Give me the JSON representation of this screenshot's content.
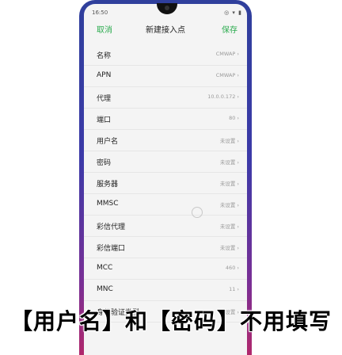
{
  "status": {
    "time": "16:50",
    "icons": "◎ ▾ ▮"
  },
  "header": {
    "cancel_label": "取消",
    "title": "新建接入点",
    "save_label": "保存"
  },
  "rows": [
    {
      "label": "名称",
      "value": "CMWAP ›"
    },
    {
      "label": "APN",
      "value": "CMWAP ›"
    },
    {
      "label": "代理",
      "value": "10.0.0.172 ›"
    },
    {
      "label": "端口",
      "value": "80 ›"
    },
    {
      "label": "用户名",
      "value": "未设置 ›"
    },
    {
      "label": "密码",
      "value": "未设置 ›"
    },
    {
      "label": "服务器",
      "value": "未设置 ›"
    },
    {
      "label": "MMSC",
      "value": "未设置 ›"
    },
    {
      "label": "彩信代理",
      "value": "未设置 ›"
    },
    {
      "label": "彩信端口",
      "value": "未设置 ›"
    },
    {
      "label": "MCC",
      "value": "460 ›"
    },
    {
      "label": "MNC",
      "value": "11 ›"
    },
    {
      "label": "身份验证类型",
      "value": "未设置 ›"
    }
  ],
  "caption": "【用户名】和【密码】不用填写"
}
